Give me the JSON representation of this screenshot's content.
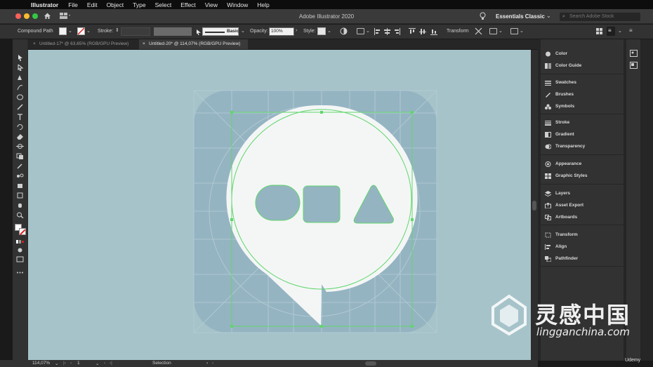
{
  "menubar": {
    "app": "Illustrator",
    "items": [
      "File",
      "Edit",
      "Object",
      "Type",
      "Select",
      "Effect",
      "View",
      "Window",
      "Help"
    ]
  },
  "titlebar": {
    "title": "Adobe Illustrator 2020",
    "workspace": "Essentials Classic",
    "search_placeholder": "Search Adobe Stock"
  },
  "control": {
    "selection_type": "Compound Path",
    "stroke_label": "Stroke:",
    "brush_label": "Basic",
    "opacity_label": "Opacity:",
    "opacity_value": "100%",
    "style_label": "Style:",
    "transform_label": "Transform"
  },
  "tabs": [
    {
      "label": "Untitled-17* @ 63,65% (RGB/GPU Preview)",
      "active": false
    },
    {
      "label": "Untitled-20* @ 114,07% (RGB/GPU Preview)",
      "active": true
    }
  ],
  "panels": {
    "groups": [
      [
        "Color",
        "Color Guide"
      ],
      [
        "Swatches",
        "Brushes",
        "Symbols"
      ],
      [
        "Stroke",
        "Gradient",
        "Transparency"
      ],
      [
        "Appearance",
        "Graphic Styles"
      ],
      [
        "Layers",
        "Asset Export",
        "Artboards"
      ],
      [
        "Transform",
        "Align",
        "Pathfinder"
      ]
    ]
  },
  "status": {
    "zoom": "114,07%",
    "artboard": "1",
    "tool": "Selection"
  },
  "watermark": {
    "cn": "灵感中国",
    "url": "lingganchina.com",
    "udemy": "Udemy"
  },
  "colors": {
    "canvas": "#a6c3c9",
    "icon_bg": "#95b4c2",
    "bubble": "#f4f6f6",
    "selection": "#5fd66b",
    "ui_dark": "#323232"
  }
}
